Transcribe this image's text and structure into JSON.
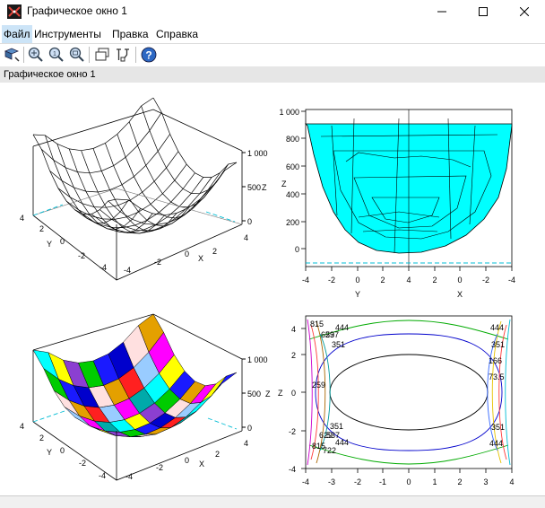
{
  "window": {
    "title": "Графическое окно 1"
  },
  "menu": [
    {
      "label": "Файл"
    },
    {
      "label": "Инструменты"
    },
    {
      "label": "Правка"
    },
    {
      "label": "Справка"
    }
  ],
  "toolbar": {
    "items": [
      "rotate-icon",
      "zoom-icon",
      "zoom-reset-icon",
      "zoom-region-icon",
      "windows-icon",
      "datatip-icon",
      "help-icon"
    ]
  },
  "figure_name": "Графическое окно 1",
  "colors": {
    "fill": "#00ffff",
    "accent": "#e4443a"
  },
  "chart_data": [
    {
      "type": "surface-wireframe",
      "z_ticks": [
        "1 000",
        "500",
        "0"
      ],
      "z_label": "Z",
      "x_ticks": [
        "4",
        "2",
        "0",
        "-2",
        "-4"
      ],
      "y_ticks": [
        "4",
        "2",
        "0",
        "-2",
        "-4"
      ],
      "x_label": "X",
      "y_label": "Y"
    },
    {
      "type": "surface-filled-projection",
      "y_ticks": [
        "1 000",
        "800",
        "600",
        "400",
        "200",
        "0"
      ],
      "z_label": "Z",
      "x_ticks": [
        "-4",
        "-2",
        "0",
        "2",
        "4",
        "2",
        "0",
        "-2",
        "-4"
      ],
      "y_axis_label": "Y",
      "x_axis_label": "X"
    },
    {
      "type": "surface-colored",
      "z_ticks": [
        "1 000",
        "500",
        "0"
      ],
      "z_label": "Z",
      "x_ticks": [
        "4",
        "2",
        "0",
        "-2",
        "-4"
      ],
      "y_ticks": [
        "4",
        "2",
        "0",
        "-2",
        "-4"
      ],
      "x_label": "X",
      "y_label": "Y"
    },
    {
      "type": "contour",
      "y_ticks": [
        "4",
        "2",
        "0",
        "-2",
        "-4"
      ],
      "x_ticks": [
        "-4",
        "-3",
        "-2",
        "-1",
        "0",
        "1",
        "2",
        "3",
        "4"
      ],
      "z_label": "Z",
      "levels": [
        "815",
        "444",
        "537",
        "629",
        "351",
        "166",
        "259",
        "73.5",
        "444",
        "351"
      ],
      "level_labels": [
        {
          "text": "815"
        },
        {
          "text": "444"
        },
        {
          "text": "629"
        },
        {
          "text": "537"
        },
        {
          "text": "351"
        },
        {
          "text": "444"
        },
        {
          "text": "351"
        },
        {
          "text": "166"
        },
        {
          "text": "259"
        },
        {
          "text": "73.5"
        },
        {
          "text": "351"
        },
        {
          "text": "629"
        },
        {
          "text": "537"
        },
        {
          "text": "815"
        },
        {
          "text": "722"
        },
        {
          "text": "444"
        },
        {
          "text": "351"
        },
        {
          "text": "444"
        }
      ]
    }
  ]
}
